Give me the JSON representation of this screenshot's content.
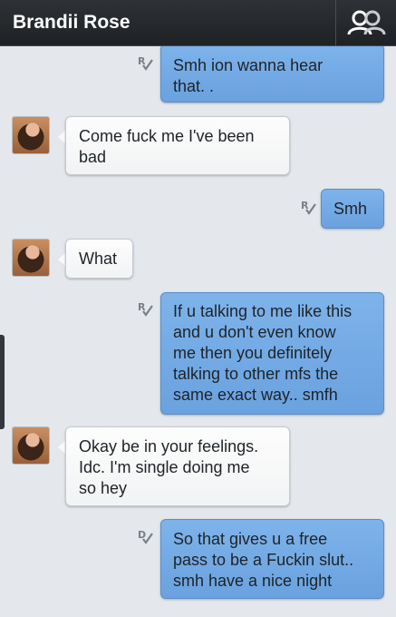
{
  "header": {
    "title": "Brandii Rose",
    "contacts_icon": "contacts-icon"
  },
  "colors": {
    "header_bg": "#25282c",
    "chat_bg": "#e4e7eb",
    "outgoing_bubble": "#72a9e4",
    "incoming_bubble": "#f8f9f9"
  },
  "messages": [
    {
      "direction": "outgoing",
      "status": "R",
      "text": "Smh ion wanna hear\nthat. ."
    },
    {
      "direction": "incoming",
      "text": "Come fuck me I've been\nbad"
    },
    {
      "direction": "outgoing",
      "status": "R",
      "text": "Smh"
    },
    {
      "direction": "incoming",
      "text": "What"
    },
    {
      "direction": "outgoing",
      "status": "R",
      "text": "If u talking to me like this\nand u don't even know\nme then you definitely\ntalking to other mfs the\nsame exact way.. smfh"
    },
    {
      "direction": "incoming",
      "text": "Okay be in your feelings.\nIdc. I'm single doing me\nso hey"
    },
    {
      "direction": "outgoing",
      "status": "D",
      "text": "So that gives u a free\npass to be a Fuckin slut..\nsmh have a nice night"
    }
  ]
}
